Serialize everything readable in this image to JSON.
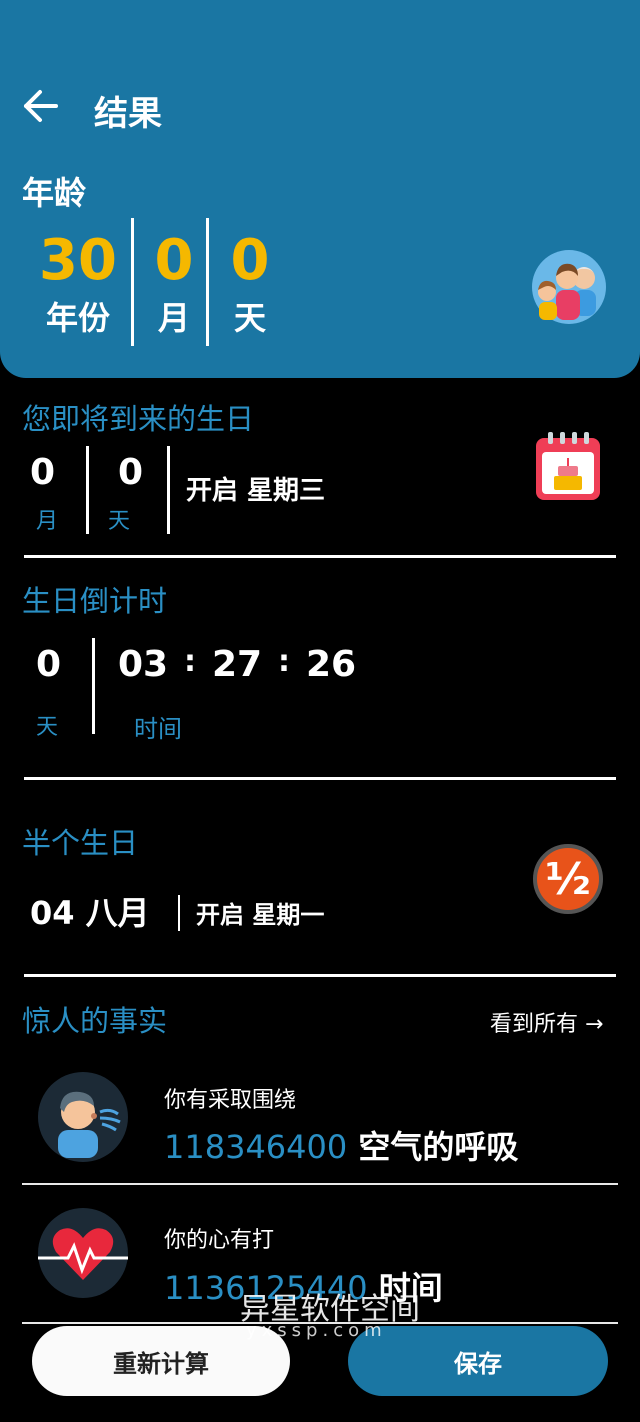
{
  "header": {
    "title": "结果",
    "age_label": "年龄",
    "age": [
      {
        "value": "30",
        "unit": "年份"
      },
      {
        "value": "0",
        "unit": "月"
      },
      {
        "value": "0",
        "unit": "天"
      }
    ]
  },
  "upcoming_birthday": {
    "title": "您即将到来的生日",
    "months": "0",
    "months_unit": "月",
    "days": "0",
    "days_unit": "天",
    "weekday": "开启 星期三"
  },
  "countdown": {
    "title": "生日倒计时",
    "days": "0",
    "days_unit": "天",
    "hours": "03",
    "minutes": "27",
    "seconds": "26",
    "time_unit": "时间"
  },
  "half_birthday": {
    "title": "半个生日",
    "date": "04 八月",
    "weekday": "开启 星期一",
    "badge": "½"
  },
  "facts": {
    "title": "惊人的事实",
    "see_all": "看到所有 →",
    "items": [
      {
        "label": "你有采取围绕",
        "value": "118346400",
        "suffix": " 空气的呼吸"
      },
      {
        "label": "你的心有打",
        "value": "1136125440",
        "suffix": " 时间"
      }
    ]
  },
  "buttons": {
    "recalculate": "重新计算",
    "save": "保存"
  },
  "watermark": {
    "text": "异星软件空间",
    "sub": "yxssp.com"
  },
  "colors": {
    "header_bg": "#1a76a3",
    "accent_blue": "#2a8fc4",
    "age_yellow": "#f5b800"
  }
}
